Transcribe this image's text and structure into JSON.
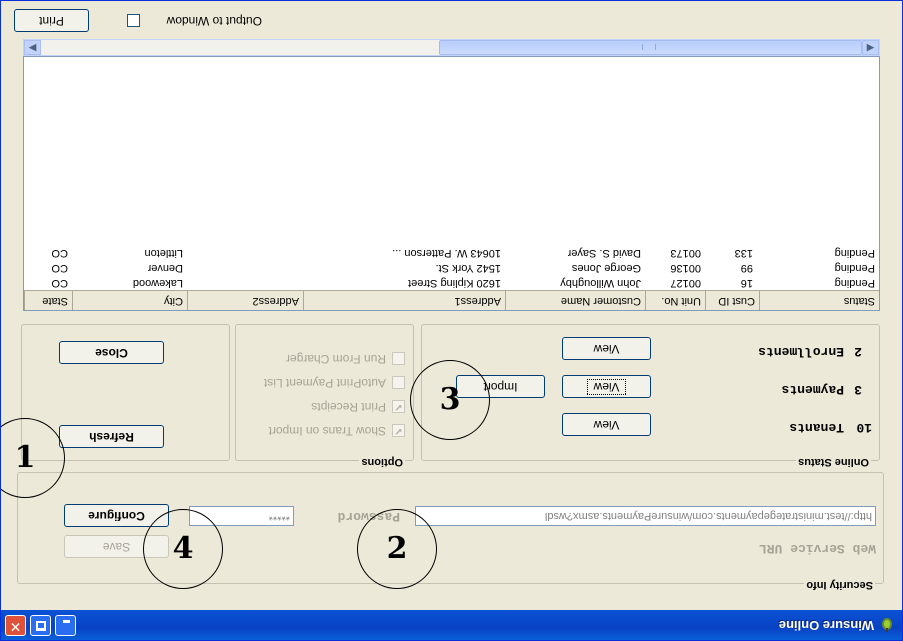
{
  "window": {
    "title": "Winsure Online",
    "colors": {
      "titlebar": "#0a52d6",
      "face": "#ece9d8",
      "close_button": "#e0513a"
    }
  },
  "security": {
    "legend": "Security Info",
    "web_service_label": "Web Service URL",
    "url_value": "http://test.ministrategepayments.com/winsurePayments.asmx?wsdl",
    "password_label": "Password",
    "password_value": "*****",
    "save_label": "Save",
    "configure_label": "Configure"
  },
  "online_status": {
    "legend": "Online Status",
    "rows": [
      {
        "count": "10",
        "label": "Tenants",
        "view": "View"
      },
      {
        "count": "3",
        "label": "Payments",
        "view": "View",
        "import": "Import"
      },
      {
        "count": "2",
        "label": "Enrollments",
        "view": "View"
      }
    ]
  },
  "options": {
    "legend": "Options",
    "items": [
      {
        "label": "Show Trans on Import",
        "checked": true
      },
      {
        "label": "Print Receipts",
        "checked": true
      },
      {
        "label": "AutoPrint Payment List",
        "checked": false
      },
      {
        "label": "Run From Charger",
        "checked": false
      }
    ]
  },
  "actions": {
    "refresh_label": "Refresh",
    "close_label": "Close"
  },
  "grid": {
    "columns": [
      "Status",
      "Cust ID",
      "Unit No.",
      "Customer Name",
      "Address1",
      "Address2",
      "City",
      "State"
    ],
    "rows": [
      [
        "Pending",
        "16",
        "00127",
        "John Willoughby",
        "1620 Kipling Street",
        "",
        "Lakewood",
        "CO"
      ],
      [
        "Pending",
        "99",
        "00136",
        "George Jones",
        "1542 York St.",
        "",
        "Denver",
        "CO"
      ],
      [
        "Pending",
        "133",
        "00173",
        "David S. Sayer",
        "10643 W. Patterson ...",
        "",
        "Littleton",
        "CO"
      ]
    ]
  },
  "footer": {
    "output_label": "Output to Window",
    "print_label": "Print"
  },
  "annotations": [
    "1",
    "2",
    "3",
    "4"
  ],
  "icons": [
    "app-icon",
    "minimize-icon",
    "maximize-icon",
    "close-icon",
    "scroll-left-icon",
    "scroll-right-icon",
    "checkmark-icon"
  ]
}
